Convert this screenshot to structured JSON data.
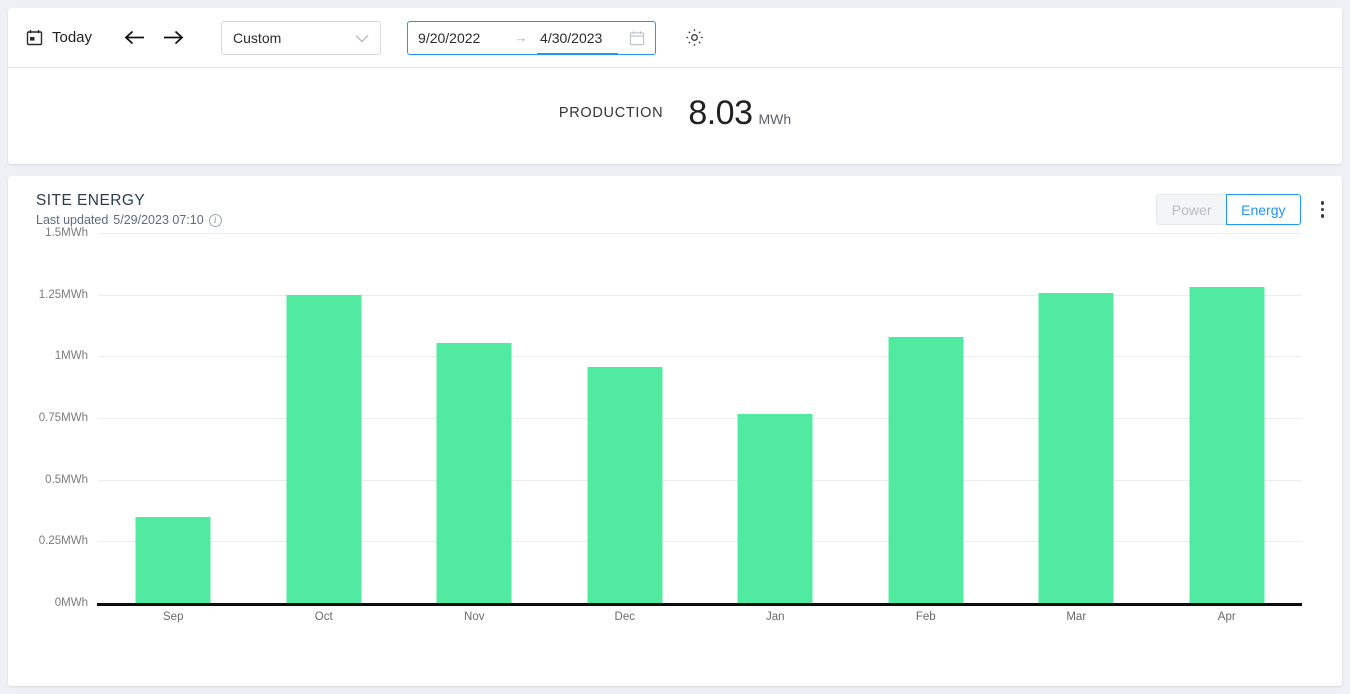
{
  "toolbar": {
    "today_label": "Today",
    "calendar_icon": "calendar-icon",
    "prev_icon": "arrow-left-icon",
    "next_icon": "arrow-right-icon",
    "range_preset": "Custom",
    "chevron_icon": "chevron-down-icon",
    "date_start": "9/20/2022",
    "date_separator": "→",
    "date_end": "4/30/2023",
    "date_picker_icon": "calendar-picker-icon",
    "settings_icon": "gear-icon",
    "accent_color": "#2196f3"
  },
  "summary": {
    "label": "PRODUCTION",
    "value": "8.03",
    "unit": "MWh"
  },
  "chart_panel": {
    "title": "SITE ENERGY",
    "last_updated_label": "Last updated",
    "last_updated_value": "5/29/2023 07:10",
    "info_icon": "info-icon",
    "info_glyph": "i",
    "toggle": {
      "options": [
        "Power",
        "Energy"
      ],
      "selected": "Energy"
    },
    "menu_icon": "kebab-menu-icon"
  },
  "chart_data": {
    "type": "bar",
    "title": "SITE ENERGY",
    "xlabel": "",
    "ylabel": "MWh",
    "categories": [
      "Sep",
      "Oct",
      "Nov",
      "Dec",
      "Jan",
      "Feb",
      "Mar",
      "Apr"
    ],
    "values": [
      0.35,
      1.25,
      1.055,
      0.955,
      0.765,
      1.08,
      1.255,
      1.28
    ],
    "ylim": [
      0,
      1.5
    ],
    "yticks": [
      0,
      0.25,
      0.5,
      0.75,
      1,
      1.25,
      1.5
    ],
    "ytick_labels": [
      "0MWh",
      "0.25MWh",
      "0.5MWh",
      "0.75MWh",
      "1MWh",
      "1.25MWh",
      "1.5MWh"
    ],
    "grid": true,
    "legend": "none",
    "series_color": "#50eba0",
    "total_label": "PRODUCTION",
    "total_value": 8.03,
    "total_unit": "MWh"
  }
}
